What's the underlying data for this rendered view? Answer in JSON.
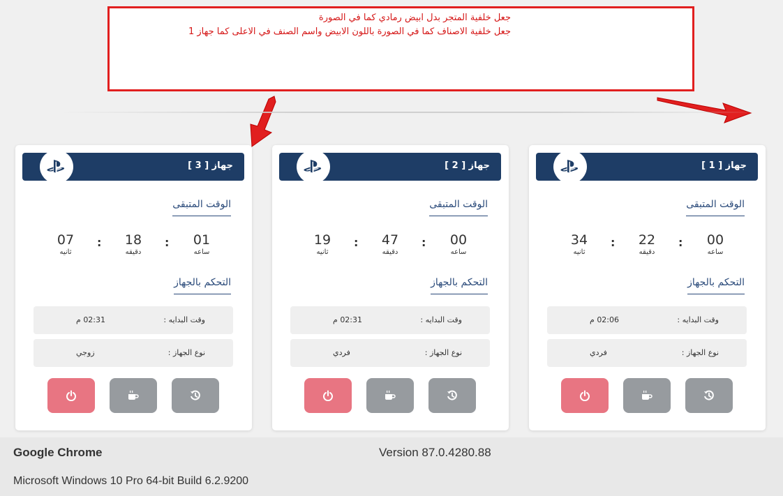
{
  "annotation": {
    "line1": "جعل خلفية المتجر بدل ابيض رمادي كما في الصورة",
    "line2": "جعل خلفية الاصناف كما في الصورة باللون الابيض واسم الصنف في الاعلى كما جهاز 1"
  },
  "colors": {
    "header": "#1e3d66",
    "power_button": "#e87582",
    "gray_button": "#979b9f",
    "annotation_red": "#e11f1f"
  },
  "cards": [
    {
      "title": "جهاز [ 3 ]",
      "remaining_label": "الوقت المتبقى",
      "hours": "01",
      "hours_label": "ساعه",
      "minutes": "18",
      "minutes_label": "دقيقه",
      "seconds": "07",
      "seconds_label": "ثانيه",
      "control_label": "التحكم بالجهاز",
      "start_label": "وقت البدايه :",
      "start_value": "02:31 م",
      "type_label": "نوع الجهاز :",
      "type_value": "زوجي",
      "icons": [
        "playstation-icon",
        "power-icon",
        "coffee-icon",
        "history-icon"
      ]
    },
    {
      "title": "جهاز [ 2 ]",
      "remaining_label": "الوقت المتبقى",
      "hours": "00",
      "hours_label": "ساعه",
      "minutes": "47",
      "minutes_label": "دقيقه",
      "seconds": "19",
      "seconds_label": "ثانيه",
      "control_label": "التحكم بالجهاز",
      "start_label": "وقت البدايه :",
      "start_value": "02:31 م",
      "type_label": "نوع الجهاز :",
      "type_value": "فردي",
      "icons": [
        "playstation-icon",
        "power-icon",
        "coffee-icon",
        "history-icon"
      ]
    },
    {
      "title": "جهاز [ 1 ]",
      "remaining_label": "الوقت المتبقى",
      "hours": "00",
      "hours_label": "ساعه",
      "minutes": "22",
      "minutes_label": "دقيقه",
      "seconds": "34",
      "seconds_label": "ثانيه",
      "control_label": "التحكم بالجهاز",
      "start_label": "وقت البدايه :",
      "start_value": "02:06 م",
      "type_label": "نوع الجهاز :",
      "type_value": "فردي",
      "icons": [
        "playstation-icon",
        "power-icon",
        "coffee-icon",
        "history-icon"
      ]
    }
  ],
  "footer": {
    "browser": "Google Chrome",
    "version": "Version 87.0.4280.88",
    "os": "Microsoft Windows 10 Pro 64-bit Build 6.2.9200"
  }
}
